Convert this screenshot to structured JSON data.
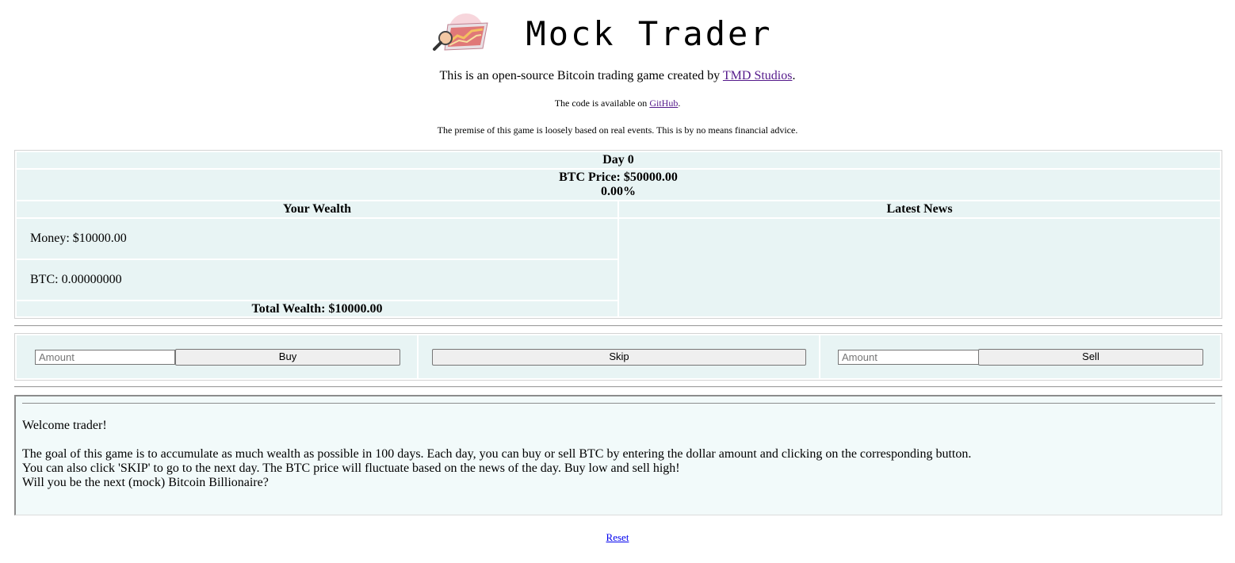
{
  "header": {
    "title": "Mock Trader",
    "intro_text": "This is an open-source Bitcoin trading game created by ",
    "intro_link": "TMD Studios",
    "intro_end": ".",
    "code_text": "The code is available on ",
    "code_link": "GitHub",
    "code_end": ".",
    "disclaimer": "The premise of this game is loosely based on real events. This is by no means financial advice."
  },
  "stats": {
    "day": "Day 0",
    "btc_price": "BTC Price: $50000.00",
    "change": "0.00%",
    "wealth_heading": "Your Wealth",
    "news_heading": "Latest News",
    "money": "Money: $10000.00",
    "btc": "BTC: 0.00000000",
    "total": "Total Wealth: $10000.00",
    "news": ""
  },
  "controls": {
    "buy_placeholder": "Amount",
    "buy_label": "Buy",
    "skip_label": "Skip",
    "sell_placeholder": "Amount",
    "sell_label": "Sell"
  },
  "messages": {
    "welcome": "Welcome trader!",
    "line1": "The goal of this game is to accumulate as much wealth as possible in 100 days. Each day, you can buy or sell BTC by entering the dollar amount and clicking on the corresponding button.",
    "line2": "You can also click 'SKIP' to go to the next day. The BTC price will fluctuate based on the news of the day. Buy low and sell high!",
    "line3": "Will you be the next (mock) Bitcoin Billionaire?"
  },
  "footer": {
    "reset_label": "Reset"
  },
  "colors": {
    "panel_bg": "#e8f4f4",
    "message_bg": "#f2fafa",
    "visited_link": "#551a8b",
    "link": "#0000ee"
  },
  "icons": {
    "logo": "chart-magnifier-logo"
  }
}
